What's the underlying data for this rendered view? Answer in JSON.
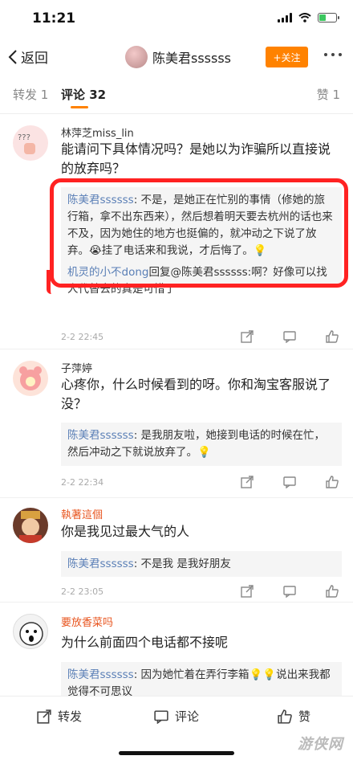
{
  "status_bar": {
    "time": "11:21"
  },
  "nav": {
    "back_label": "返回",
    "title": "陈美君ssssss",
    "follow_label": "+关注"
  },
  "tabs": {
    "repost": "转发 1",
    "comments": "评论 32",
    "likes": "赞 1"
  },
  "comments": [
    {
      "user": "林萍芝miss_lin",
      "text": "能请问下具体情况吗？是她以为诈骗所以直接说的放弃吗？",
      "replies": [
        {
          "name": "陈美君ssssss",
          "text": ": 不是，是她正在忙别的事情（修她的旅行箱，拿不出东西来），然后想着明天要去杭州的话也来不及，因为她住的地方也挺偏的，就冲动之下说了放弃。😭挂了电话来和我说，才后悔了。💡"
        },
        {
          "name": "机灵的小不dong",
          "text": "回复@陈美君ssssss:啊？好像可以找人代替去的真是可惜了"
        }
      ],
      "time": "2-2 22:45"
    },
    {
      "user": "子萍婷",
      "text": "心疼你，什么时候看到的呀。你和淘宝客服说了没？",
      "replies": [
        {
          "name": "陈美君ssssss",
          "text": ": 是我朋友啦，她接到电话的时候在忙，然后冲动之下就说放弃了。💡"
        }
      ],
      "time": "2-2 22:34"
    },
    {
      "user": "執著這個",
      "text": "你是我见过最大气的人",
      "replies": [
        {
          "name": "陈美君ssssss",
          "text": ": 不是我 是我好朋友"
        }
      ],
      "time": "2-2 23:05"
    },
    {
      "user": "要放香菜吗",
      "text": "为什么前面四个电话都不接呢",
      "replies": [
        {
          "name": "陈美君ssssss",
          "text": ": 因为她忙着在弄行李箱💡💡说出来我都觉得不可思议"
        }
      ]
    }
  ],
  "bottom_bar": {
    "repost": "转发",
    "comment": "评论",
    "like": "赞"
  },
  "watermark": "游侠网",
  "colors": {
    "accent": "#ff8200",
    "link": "#5a7fb6",
    "highlight": "#ff2222"
  }
}
